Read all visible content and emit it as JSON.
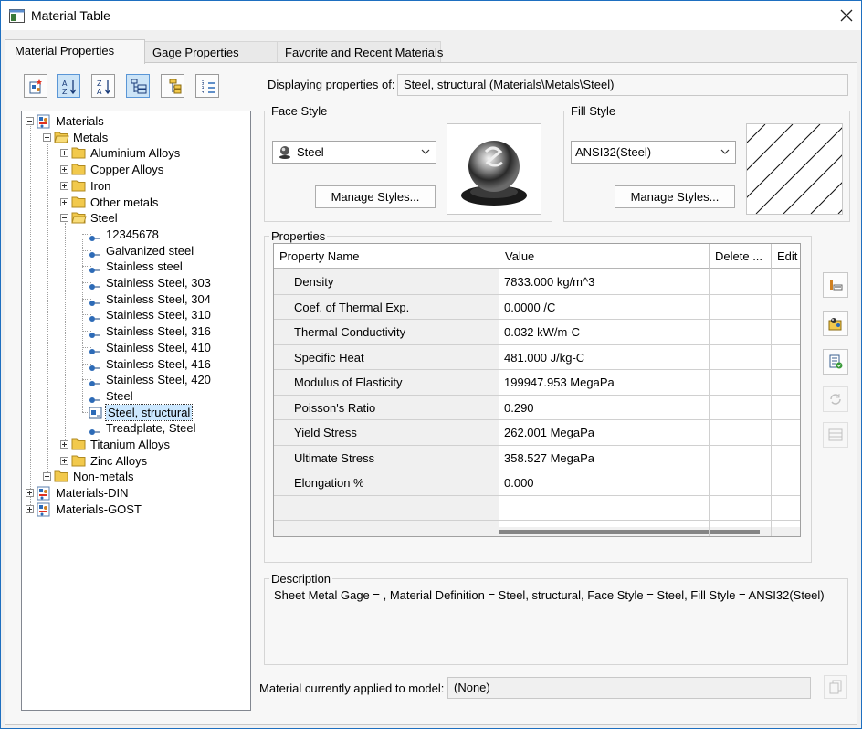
{
  "window": {
    "title": "Material Table"
  },
  "tabs": [
    {
      "label": "Material Properties",
      "active": true
    },
    {
      "label": "Gage Properties",
      "active": false
    },
    {
      "label": "Favorite and Recent Materials",
      "active": false
    }
  ],
  "toolbar": {
    "buttons": [
      {
        "icon": "new-material-icon",
        "pressed": false
      },
      {
        "icon": "sort-ascending-icon",
        "pressed": true
      },
      {
        "icon": "sort-descending-icon",
        "pressed": false
      },
      {
        "icon": "tree-view-icon",
        "pressed": true
      },
      {
        "icon": "folder-view-icon",
        "pressed": false
      },
      {
        "icon": "list-view-icon",
        "pressed": false
      }
    ]
  },
  "tree": {
    "items": [
      {
        "label": "Materials",
        "level": 0,
        "type": "library",
        "expander": "minus"
      },
      {
        "label": "Metals",
        "level": 1,
        "type": "folder-open",
        "expander": "minus"
      },
      {
        "label": "Aluminium Alloys",
        "level": 2,
        "type": "folder",
        "expander": "plus"
      },
      {
        "label": "Copper Alloys",
        "level": 2,
        "type": "folder",
        "expander": "plus"
      },
      {
        "label": "Iron",
        "level": 2,
        "type": "folder",
        "expander": "plus"
      },
      {
        "label": "Other metals",
        "level": 2,
        "type": "folder",
        "expander": "plus"
      },
      {
        "label": "Steel",
        "level": 2,
        "type": "folder-open",
        "expander": "minus"
      },
      {
        "label": "12345678",
        "level": 3,
        "type": "material"
      },
      {
        "label": "Galvanized steel",
        "level": 3,
        "type": "material"
      },
      {
        "label": "Stainless steel",
        "level": 3,
        "type": "material"
      },
      {
        "label": "Stainless Steel, 303",
        "level": 3,
        "type": "material"
      },
      {
        "label": "Stainless Steel, 304",
        "level": 3,
        "type": "material"
      },
      {
        "label": "Stainless Steel, 310",
        "level": 3,
        "type": "material"
      },
      {
        "label": "Stainless Steel, 316",
        "level": 3,
        "type": "material"
      },
      {
        "label": "Stainless Steel, 410",
        "level": 3,
        "type": "material"
      },
      {
        "label": "Stainless Steel, 416",
        "level": 3,
        "type": "material"
      },
      {
        "label": "Stainless Steel, 420",
        "level": 3,
        "type": "material"
      },
      {
        "label": "Steel",
        "level": 3,
        "type": "material"
      },
      {
        "label": "Steel, structural",
        "level": 3,
        "type": "material-selected",
        "selected": true
      },
      {
        "label": "Treadplate, Steel",
        "level": 3,
        "type": "material"
      },
      {
        "label": "Titanium Alloys",
        "level": 2,
        "type": "folder",
        "expander": "plus"
      },
      {
        "label": "Zinc Alloys",
        "level": 2,
        "type": "folder",
        "expander": "plus"
      },
      {
        "label": "Non-metals",
        "level": 1,
        "type": "folder",
        "expander": "plus"
      },
      {
        "label": "Materials-DIN",
        "level": 0,
        "type": "library",
        "expander": "plus"
      },
      {
        "label": "Materials-GOST",
        "level": 0,
        "type": "library",
        "expander": "plus"
      }
    ]
  },
  "displaying": {
    "label": "Displaying properties of:",
    "value": "Steel, structural (Materials\\Metals\\Steel)"
  },
  "face_style": {
    "group_label": "Face Style",
    "selected": "Steel",
    "button": "Manage Styles..."
  },
  "fill_style": {
    "group_label": "Fill Style",
    "selected": "ANSI32(Steel)",
    "button": "Manage Styles..."
  },
  "properties": {
    "group_label": "Properties",
    "columns": [
      "Property Name",
      "Value",
      "Delete ...",
      "Edit"
    ],
    "rows": [
      {
        "name": "Density",
        "value": "7833.000 kg/m^3"
      },
      {
        "name": "Coef. of Thermal Exp.",
        "value": "0.0000 /C"
      },
      {
        "name": "Thermal Conductivity",
        "value": "0.032 kW/m-C"
      },
      {
        "name": "Specific Heat",
        "value": "481.000 J/kg-C"
      },
      {
        "name": "Modulus of Elasticity",
        "value": "199947.953 MegaPa"
      },
      {
        "name": "Poisson's Ratio",
        "value": "0.290"
      },
      {
        "name": "Yield Stress",
        "value": "262.001 MegaPa"
      },
      {
        "name": "Ultimate Stress",
        "value": "358.527 MegaPa"
      },
      {
        "name": "Elongation %",
        "value": "0.000"
      },
      {
        "name": "",
        "value": ""
      },
      {
        "name": "",
        "value": ""
      }
    ]
  },
  "side_buttons": [
    {
      "icon": "add-property-icon",
      "enabled": true
    },
    {
      "icon": "edit-material-icon",
      "enabled": true
    },
    {
      "icon": "save-material-icon",
      "enabled": true
    },
    {
      "icon": "apply-material-icon",
      "enabled": false
    },
    {
      "icon": "table-icon",
      "enabled": false
    }
  ],
  "description": {
    "group_label": "Description",
    "text": "Sheet Metal Gage = , Material Definition = Steel, structural, Face Style = Steel, Fill Style = ANSI32(Steel)"
  },
  "applied": {
    "label": "Material currently applied to model:",
    "value": "(None)",
    "button_icon": "copy-icon"
  }
}
